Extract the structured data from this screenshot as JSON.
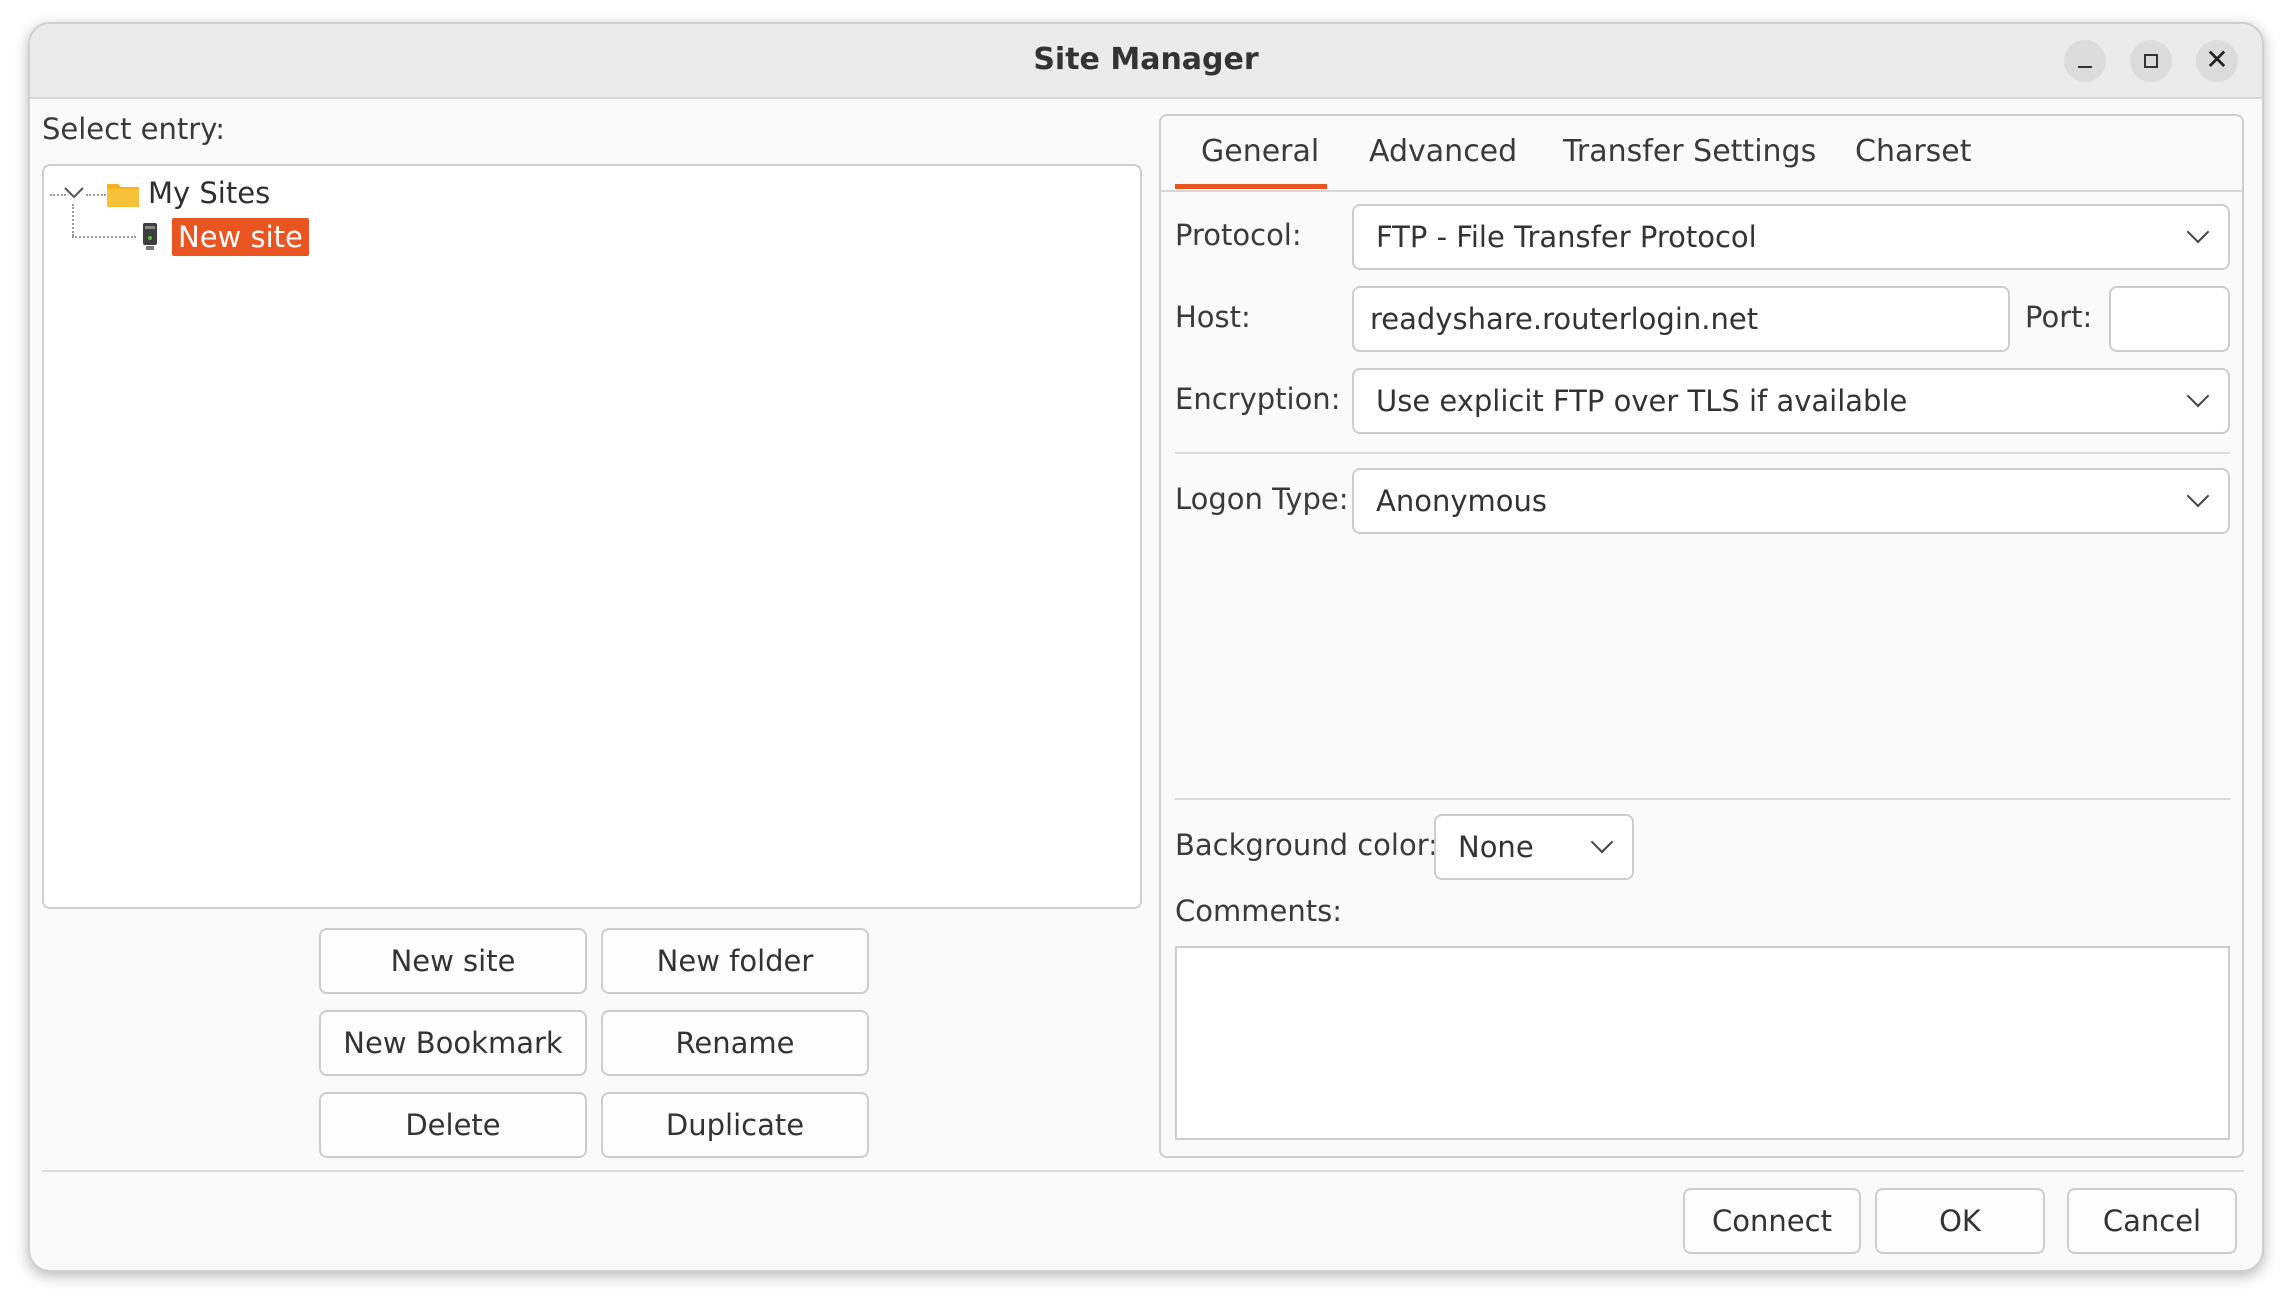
{
  "window": {
    "title": "Site Manager",
    "controls": {
      "minimize": "minimize-icon",
      "maximize": "maximize-icon",
      "close": "close-icon",
      "close_glyph": "✕"
    }
  },
  "left": {
    "select_entry_label": "Select entry:",
    "tree": {
      "root": "My Sites",
      "child": "New site"
    },
    "buttons": {
      "new_site": "New site",
      "new_folder": "New folder",
      "new_bookmark": "New Bookmark",
      "rename": "Rename",
      "delete": "Delete",
      "duplicate": "Duplicate"
    }
  },
  "tabs": {
    "general": "General",
    "advanced": "Advanced",
    "transfer": "Transfer Settings",
    "charset": "Charset",
    "active": "General"
  },
  "general": {
    "protocol_label": "Protocol:",
    "protocol_value": "FTP - File Transfer Protocol",
    "host_label": "Host:",
    "host_value": "readyshare.routerlogin.net",
    "port_label": "Port:",
    "port_value": "",
    "encryption_label": "Encryption:",
    "encryption_value": "Use explicit FTP over TLS if available",
    "logon_label": "Logon Type:",
    "logon_value": "Anonymous",
    "bgcolor_label": "Background color:",
    "bgcolor_value": "None",
    "comments_label": "Comments:",
    "comments_value": ""
  },
  "footer": {
    "connect": "Connect",
    "ok": "OK",
    "cancel": "Cancel"
  },
  "colors": {
    "accent": "#e95420",
    "folder": "#f6b21a"
  }
}
